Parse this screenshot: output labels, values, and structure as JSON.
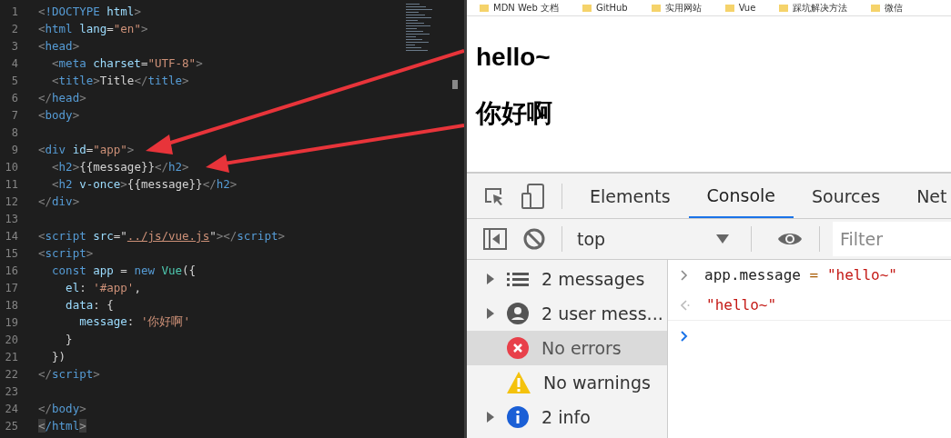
{
  "editor": {
    "lines": [
      {
        "number": "1",
        "tokens": [
          {
            "text": "<",
            "kind": "b"
          },
          {
            "text": "!DOCTYPE",
            "kind": "t"
          },
          {
            "text": " html",
            "kind": "a"
          },
          {
            "text": ">",
            "kind": "b"
          }
        ]
      },
      {
        "number": "2",
        "tokens": [
          {
            "text": "<",
            "kind": "b"
          },
          {
            "text": "html",
            "kind": "t"
          },
          {
            "text": " lang",
            "kind": "a"
          },
          {
            "text": "=",
            "kind": "p"
          },
          {
            "text": "\"en\"",
            "kind": "s"
          },
          {
            "text": ">",
            "kind": "b"
          }
        ]
      },
      {
        "number": "3",
        "tokens": [
          {
            "text": "<",
            "kind": "b"
          },
          {
            "text": "head",
            "kind": "t"
          },
          {
            "text": ">",
            "kind": "b"
          }
        ]
      },
      {
        "number": "4",
        "tokens": [
          {
            "text": "  <",
            "kind": "b"
          },
          {
            "text": "meta",
            "kind": "t"
          },
          {
            "text": " charset",
            "kind": "a"
          },
          {
            "text": "=",
            "kind": "p"
          },
          {
            "text": "\"UTF-8\"",
            "kind": "s"
          },
          {
            "text": ">",
            "kind": "b"
          }
        ]
      },
      {
        "number": "5",
        "tokens": [
          {
            "text": "  <",
            "kind": "b"
          },
          {
            "text": "title",
            "kind": "t"
          },
          {
            "text": ">",
            "kind": "b"
          },
          {
            "text": "Title",
            "kind": "p"
          },
          {
            "text": "</",
            "kind": "b"
          },
          {
            "text": "title",
            "kind": "t"
          },
          {
            "text": ">",
            "kind": "b"
          }
        ]
      },
      {
        "number": "6",
        "tokens": [
          {
            "text": "</",
            "kind": "b"
          },
          {
            "text": "head",
            "kind": "t"
          },
          {
            "text": ">",
            "kind": "b"
          }
        ]
      },
      {
        "number": "7",
        "tokens": [
          {
            "text": "<",
            "kind": "b"
          },
          {
            "text": "body",
            "kind": "t"
          },
          {
            "text": ">",
            "kind": "b"
          }
        ]
      },
      {
        "number": "8"
      },
      {
        "number": "9",
        "tokens": [
          {
            "text": "<",
            "kind": "b"
          },
          {
            "text": "div",
            "kind": "t"
          },
          {
            "text": " id",
            "kind": "a"
          },
          {
            "text": "=",
            "kind": "p"
          },
          {
            "text": "\"app\"",
            "kind": "s"
          },
          {
            "text": ">",
            "kind": "b"
          }
        ]
      },
      {
        "number": "10",
        "tokens": [
          {
            "text": "  <",
            "kind": "b"
          },
          {
            "text": "h2",
            "kind": "t"
          },
          {
            "text": ">",
            "kind": "b"
          },
          {
            "text": "{{message}}",
            "kind": "p"
          },
          {
            "text": "</",
            "kind": "b"
          },
          {
            "text": "h2",
            "kind": "t"
          },
          {
            "text": ">",
            "kind": "b"
          }
        ]
      },
      {
        "number": "11",
        "tokens": [
          {
            "text": "  <",
            "kind": "b"
          },
          {
            "text": "h2",
            "kind": "t"
          },
          {
            "text": " v-once",
            "kind": "a"
          },
          {
            "text": ">",
            "kind": "b"
          },
          {
            "text": "{{message}}",
            "kind": "p"
          },
          {
            "text": "</",
            "kind": "b"
          },
          {
            "text": "h2",
            "kind": "t"
          },
          {
            "text": ">",
            "kind": "b"
          }
        ]
      },
      {
        "number": "12",
        "tokens": [
          {
            "text": "</",
            "kind": "b"
          },
          {
            "text": "div",
            "kind": "t"
          },
          {
            "text": ">",
            "kind": "b"
          }
        ]
      },
      {
        "number": "13"
      },
      {
        "number": "14",
        "tokens": [
          {
            "text": "<",
            "kind": "b"
          },
          {
            "text": "script",
            "kind": "t"
          },
          {
            "text": " src",
            "kind": "a"
          },
          {
            "text": "=\"",
            "kind": "p"
          },
          {
            "text": "../js/vue.js",
            "kind": "u"
          },
          {
            "text": "\"",
            "kind": "p"
          },
          {
            "text": "></",
            "kind": "b"
          },
          {
            "text": "script",
            "kind": "t"
          },
          {
            "text": ">",
            "kind": "b"
          }
        ]
      },
      {
        "number": "15",
        "tokens": [
          {
            "text": "<",
            "kind": "b"
          },
          {
            "text": "script",
            "kind": "t"
          },
          {
            "text": ">",
            "kind": "b"
          }
        ]
      },
      {
        "number": "16",
        "tokens": [
          {
            "text": "  const",
            "kind": "k"
          },
          {
            "text": " app",
            "kind": "a"
          },
          {
            "text": " = ",
            "kind": "p"
          },
          {
            "text": "new",
            "kind": "k"
          },
          {
            "text": " Vue",
            "kind": "c"
          },
          {
            "text": "({",
            "kind": "p"
          }
        ]
      },
      {
        "number": "17",
        "tokens": [
          {
            "text": "    el",
            "kind": "a"
          },
          {
            "text": ": ",
            "kind": "p"
          },
          {
            "text": "'#app'",
            "kind": "s"
          },
          {
            "text": ",",
            "kind": "p"
          }
        ]
      },
      {
        "number": "18",
        "tokens": [
          {
            "text": "    data",
            "kind": "a"
          },
          {
            "text": ": {",
            "kind": "p"
          }
        ]
      },
      {
        "number": "19",
        "tokens": [
          {
            "text": "      message",
            "kind": "a"
          },
          {
            "text": ": ",
            "kind": "p"
          },
          {
            "text": "'你好啊'",
            "kind": "s"
          }
        ]
      },
      {
        "number": "20",
        "tokens": [
          {
            "text": "    }",
            "kind": "p"
          }
        ]
      },
      {
        "number": "21",
        "tokens": [
          {
            "text": "  })",
            "kind": "p"
          }
        ]
      },
      {
        "number": "22",
        "tokens": [
          {
            "text": "</",
            "kind": "b"
          },
          {
            "text": "script",
            "kind": "t"
          },
          {
            "text": ">",
            "kind": "b"
          }
        ]
      },
      {
        "number": "23"
      },
      {
        "number": "24",
        "tokens": [
          {
            "text": "</",
            "kind": "b"
          },
          {
            "text": "body",
            "kind": "t"
          },
          {
            "text": ">",
            "kind": "b"
          }
        ]
      },
      {
        "number": "25",
        "tokens": [
          {
            "text": "<",
            "kind": "m"
          },
          {
            "text": "/html",
            "kind": "t"
          },
          {
            "text": ">",
            "kind": "m"
          }
        ]
      }
    ]
  },
  "bookmarks": [
    "MDN Web 文档",
    "GitHub",
    "实用网站",
    "Vue",
    "踩坑解决方法",
    "微信"
  ],
  "page": {
    "headings": [
      "hello~",
      "你好啊"
    ]
  },
  "devtools": {
    "tabs": [
      {
        "label": "Elements",
        "selected": false
      },
      {
        "label": "Console",
        "selected": true
      },
      {
        "label": "Sources",
        "selected": false
      },
      {
        "label": "Net",
        "selected": false
      }
    ],
    "context": "top",
    "filter": {
      "placeholder": "Filter"
    },
    "sidebar": [
      {
        "kind": "messages",
        "label": "2 messages",
        "selected": false
      },
      {
        "kind": "user",
        "label": "2 user mess...",
        "selected": false
      },
      {
        "kind": "error",
        "label": "No errors",
        "selected": true
      },
      {
        "kind": "warning",
        "label": "No warnings",
        "selected": false
      },
      {
        "kind": "info",
        "label": "2 info",
        "selected": false
      }
    ],
    "console": [
      {
        "kind": "input",
        "tokens": [
          {
            "text": "app.message",
            "kind": "p"
          },
          {
            "text": " = ",
            "kind": "o"
          },
          {
            "text": "\"hello~\"",
            "kind": "s"
          }
        ]
      },
      {
        "kind": "output",
        "tokens": [
          {
            "text": "\"hello~\"",
            "kind": "s"
          }
        ]
      },
      {
        "kind": "prompt"
      }
    ]
  }
}
